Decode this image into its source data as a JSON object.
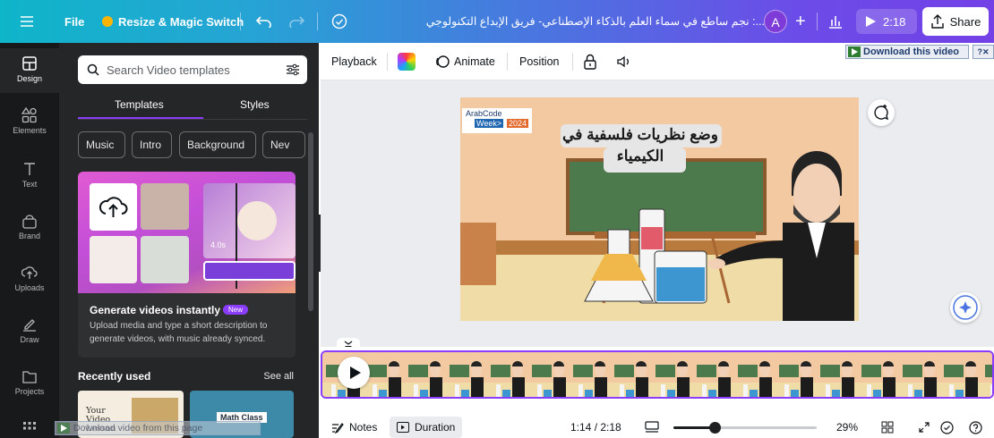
{
  "topbar": {
    "file_label": "File",
    "resize_label": "Resize & Magic Switch",
    "title": "...: نجم ساطع في سماء العلم بالذكاء الإصطناعي- فريق الإبداع التكنولوجي",
    "avatar_initial": "A",
    "duration": "2:18",
    "share_label": "Share",
    "brand_color": "#7341e6"
  },
  "rail": {
    "items": [
      {
        "label": "Design",
        "icon": "design-icon"
      },
      {
        "label": "Elements",
        "icon": "elements-icon"
      },
      {
        "label": "Text",
        "icon": "text-icon"
      },
      {
        "label": "Brand",
        "icon": "brand-icon"
      },
      {
        "label": "Uploads",
        "icon": "uploads-icon"
      },
      {
        "label": "Draw",
        "icon": "draw-icon"
      },
      {
        "label": "Projects",
        "icon": "projects-icon"
      },
      {
        "label": "",
        "icon": "apps-icon"
      }
    ]
  },
  "panel": {
    "search_placeholder": "Search Video templates",
    "tabs": [
      "Templates",
      "Styles"
    ],
    "chips": [
      "Music",
      "Intro",
      "Background",
      "Nev"
    ],
    "card": {
      "duration_badge": "4.0s",
      "title": "Generate videos instantly",
      "badge": "New",
      "description": "Upload media and type a short description to generate videos, with music already synced."
    },
    "recent_label": "Recently used",
    "see_all": "See all",
    "thumb1_text": "Your Video Lesson",
    "thumb2_text": "Math Class"
  },
  "toolbar": {
    "playback": "Playback",
    "animate": "Animate",
    "position": "Position",
    "download_video": "Download this video",
    "download_icons": "?✕"
  },
  "slide": {
    "logo_text": "ArabCode",
    "logo_sub": "Week>",
    "logo_year": "2024",
    "title": "وضع نظريات فلسفية في الكيمياء"
  },
  "bottombar": {
    "notes": "Notes",
    "duration": "Duration",
    "time": "1:14 / 2:18",
    "zoom": "29%",
    "zoom_fraction": 0.29
  },
  "overlay": {
    "download_page": "Download video from this page"
  }
}
